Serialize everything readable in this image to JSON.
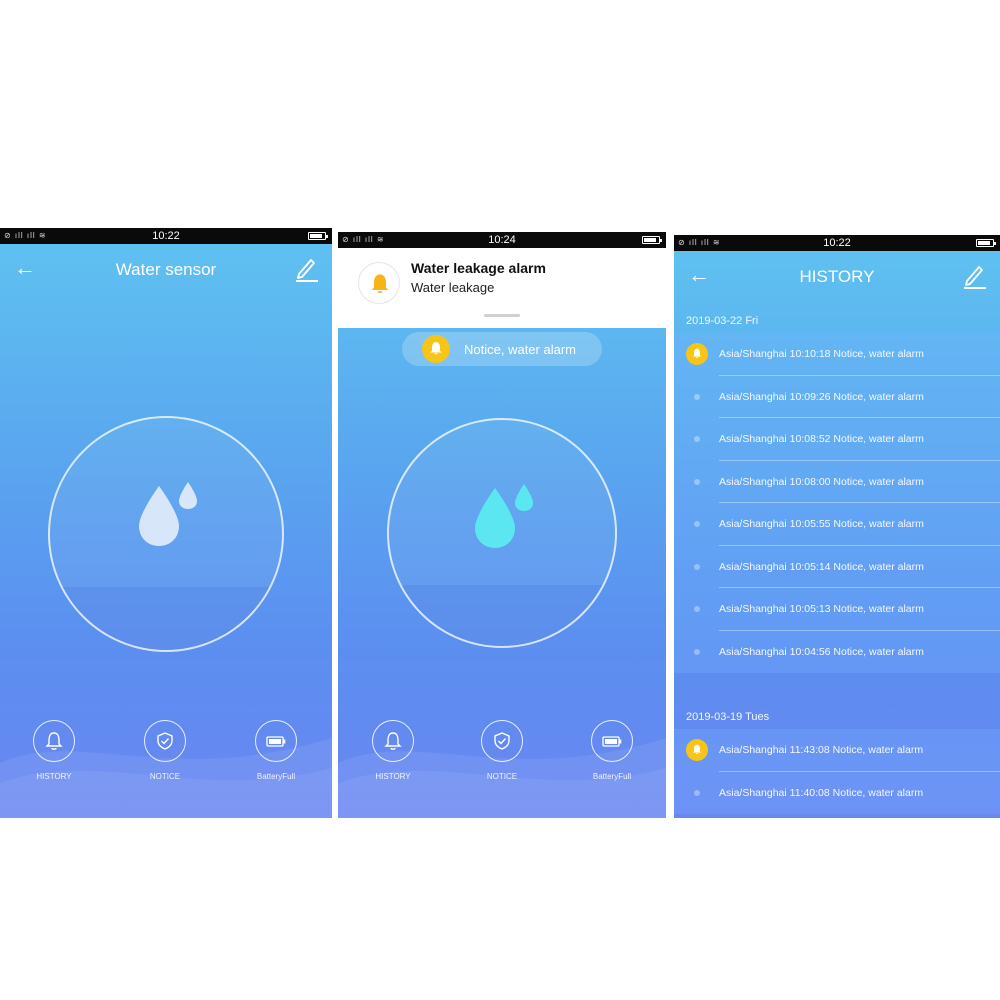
{
  "colors": {
    "accent_yellow": "#f6c518",
    "drop_light": "#d8e6fa",
    "drop_cyan": "#5ce6f2"
  },
  "screen1": {
    "status_time": "10:22",
    "title": "Water sensor",
    "buttons": [
      {
        "label": "HISTORY",
        "icon": "bell-icon"
      },
      {
        "label": "NOTICE",
        "icon": "shield-check-icon"
      },
      {
        "label": "BatteryFull",
        "icon": "battery-icon"
      }
    ]
  },
  "screen2": {
    "status_time": "10:24",
    "notification": {
      "title": "Water leakage alarm",
      "body": "Water leakage"
    },
    "toast": "Notice, water alarm",
    "buttons": [
      {
        "label": "HISTORY",
        "icon": "bell-icon"
      },
      {
        "label": "NOTICE",
        "icon": "shield-check-icon"
      },
      {
        "label": "BatteryFull",
        "icon": "battery-icon"
      }
    ]
  },
  "screen3": {
    "status_time": "10:22",
    "title": "HISTORY",
    "groups": [
      {
        "date": "2019-03-22  Fri",
        "entries": [
          {
            "text": "Asia/Shanghai 10:10:18 Notice, water alarm",
            "alarm": true
          },
          {
            "text": "Asia/Shanghai 10:09:26 Notice, water alarm",
            "alarm": false
          },
          {
            "text": "Asia/Shanghai 10:08:52 Notice, water alarm",
            "alarm": false
          },
          {
            "text": "Asia/Shanghai 10:08:00 Notice, water alarm",
            "alarm": false
          },
          {
            "text": "Asia/Shanghai 10:05:55 Notice, water alarm",
            "alarm": false
          },
          {
            "text": "Asia/Shanghai 10:05:14 Notice, water alarm",
            "alarm": false
          },
          {
            "text": "Asia/Shanghai 10:05:13 Notice, water alarm",
            "alarm": false
          },
          {
            "text": "Asia/Shanghai 10:04:56 Notice, water alarm",
            "alarm": false
          }
        ]
      },
      {
        "date": "2019-03-19  Tues",
        "entries": [
          {
            "text": "Asia/Shanghai 11:43:08 Notice, water alarm",
            "alarm": true
          },
          {
            "text": "Asia/Shanghai 11:40:08 Notice, water alarm",
            "alarm": false
          }
        ]
      }
    ]
  }
}
